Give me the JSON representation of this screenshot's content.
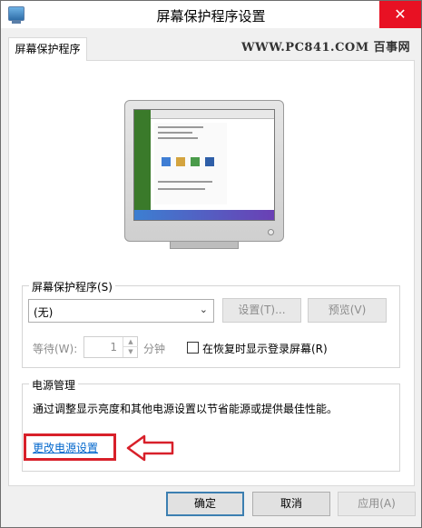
{
  "window": {
    "title": "屏幕保护程序设置",
    "close_glyph": "✕"
  },
  "tab": {
    "label": "屏幕保护程序"
  },
  "watermark": "WWW.PC841.COM 百事网",
  "screensaver": {
    "group_label": "屏幕保护程序(S)",
    "selected": "(无)",
    "settings_button": "设置(T)...",
    "preview_button": "预览(V)",
    "wait_label": "等待(W):",
    "wait_value": "1",
    "minutes_label": "分钟",
    "resume_checkbox_label": "在恢复时显示登录屏幕(R)",
    "resume_checked": false
  },
  "power": {
    "group_label": "电源管理",
    "description": "通过调整显示亮度和其他电源设置以节省能源或提供最佳性能。",
    "link": "更改电源设置"
  },
  "buttons": {
    "ok": "确定",
    "cancel": "取消",
    "apply": "应用(A)"
  },
  "colors": {
    "link": "#0066cc",
    "highlight": "#d8202a",
    "close": "#e81123"
  }
}
